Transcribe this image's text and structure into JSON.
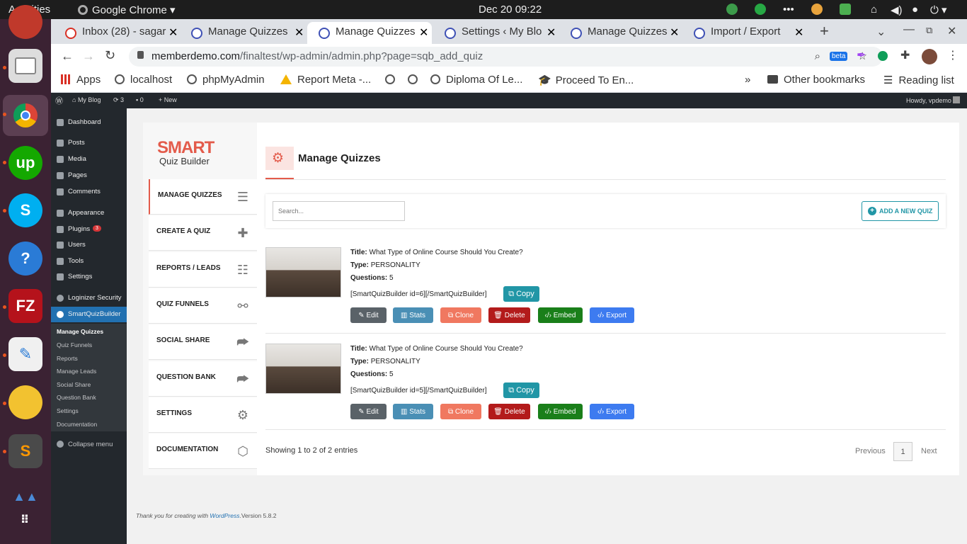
{
  "os": {
    "activities": "Activities",
    "app": "Google Chrome",
    "clock": "Dec 20  09:22"
  },
  "tabs": [
    {
      "label": "Inbox (28) - sagar",
      "active": false
    },
    {
      "label": "Manage Quizzes",
      "active": false
    },
    {
      "label": "Manage Quizzes",
      "active": true
    },
    {
      "label": "Settings ‹ My Blo",
      "active": false
    },
    {
      "label": "Manage Quizzes",
      "active": false
    },
    {
      "label": "Import / Export",
      "active": false
    }
  ],
  "url": {
    "host": "memberdemo.com",
    "path": "/finaltest/wp-admin/admin.php?page=sqb_add_quiz"
  },
  "bookmarks": [
    "Apps",
    "localhost",
    "phpMyAdmin",
    "Report Meta -...",
    "",
    "",
    "Diploma Of Le...",
    "Proceed To En..."
  ],
  "bookmarks_right": {
    "other": "Other bookmarks",
    "reading": "Reading list"
  },
  "wpbar": {
    "site": "My Blog",
    "updates": "3",
    "comments": "0",
    "new": "New",
    "howdy": "Howdy, vpdemo"
  },
  "wpmenu": {
    "items": [
      "Dashboard",
      "Posts",
      "Media",
      "Pages",
      "Comments",
      "Appearance",
      "Plugins",
      "Users",
      "Tools",
      "Settings",
      "Loginizer Security",
      "SmartQuizBuilder"
    ],
    "plugins_badge": "3",
    "sub": [
      "Manage Quizzes",
      "Quiz Funnels",
      "Reports",
      "Manage Leads",
      "Social Share",
      "Question Bank",
      "Settings",
      "Documentation"
    ],
    "collapse": "Collapse menu"
  },
  "logo": {
    "smart": "SMART",
    "sub": "Quiz Builder"
  },
  "nav": [
    "MANAGE QUIZZES",
    "CREATE A QUIZ",
    "REPORTS / LEADS",
    "QUIZ FUNNELS",
    "SOCIAL SHARE",
    "QUESTION BANK",
    "SETTINGS",
    "DOCUMENTATION"
  ],
  "page_title": "Manage Quizzes",
  "search": {
    "placeholder": "Search..."
  },
  "add_button": "ADD A NEW QUIZ",
  "labels": {
    "title": "Title:",
    "type": "Type:",
    "questions": "Questions:"
  },
  "quizzes": [
    {
      "title": "What Type of Online Course Should You Create?",
      "type": "PERSONALITY",
      "questions": "5",
      "shortcode": "[SmartQuizBuilder id=6][/SmartQuizBuilder]"
    },
    {
      "title": "What Type of Online Course Should You Create?",
      "type": "PERSONALITY",
      "questions": "5",
      "shortcode": "[SmartQuizBuilder id=5][/SmartQuizBuilder]"
    }
  ],
  "actions": {
    "copy": "Copy",
    "edit": "Edit",
    "stats": "Stats",
    "clone": "Clone",
    "delete": "Delete",
    "embed": "Embed",
    "export": "Export"
  },
  "pagination": {
    "showing": "Showing 1 to 2 of 2 entries",
    "previous": "Previous",
    "page": "1",
    "next": "Next"
  },
  "footer": {
    "thanks": "Thank you for creating with ",
    "wp": "WordPress",
    "version": ".Version 5.8.2"
  },
  "colors": {
    "accent": "#e35b4b",
    "teal": "#2196a6",
    "edit": "#5a6268",
    "stats": "#4a8fb5",
    "clone": "#f07860",
    "delete": "#b31b1b",
    "embed": "#1a7f1a",
    "export": "#3d7bf0"
  }
}
